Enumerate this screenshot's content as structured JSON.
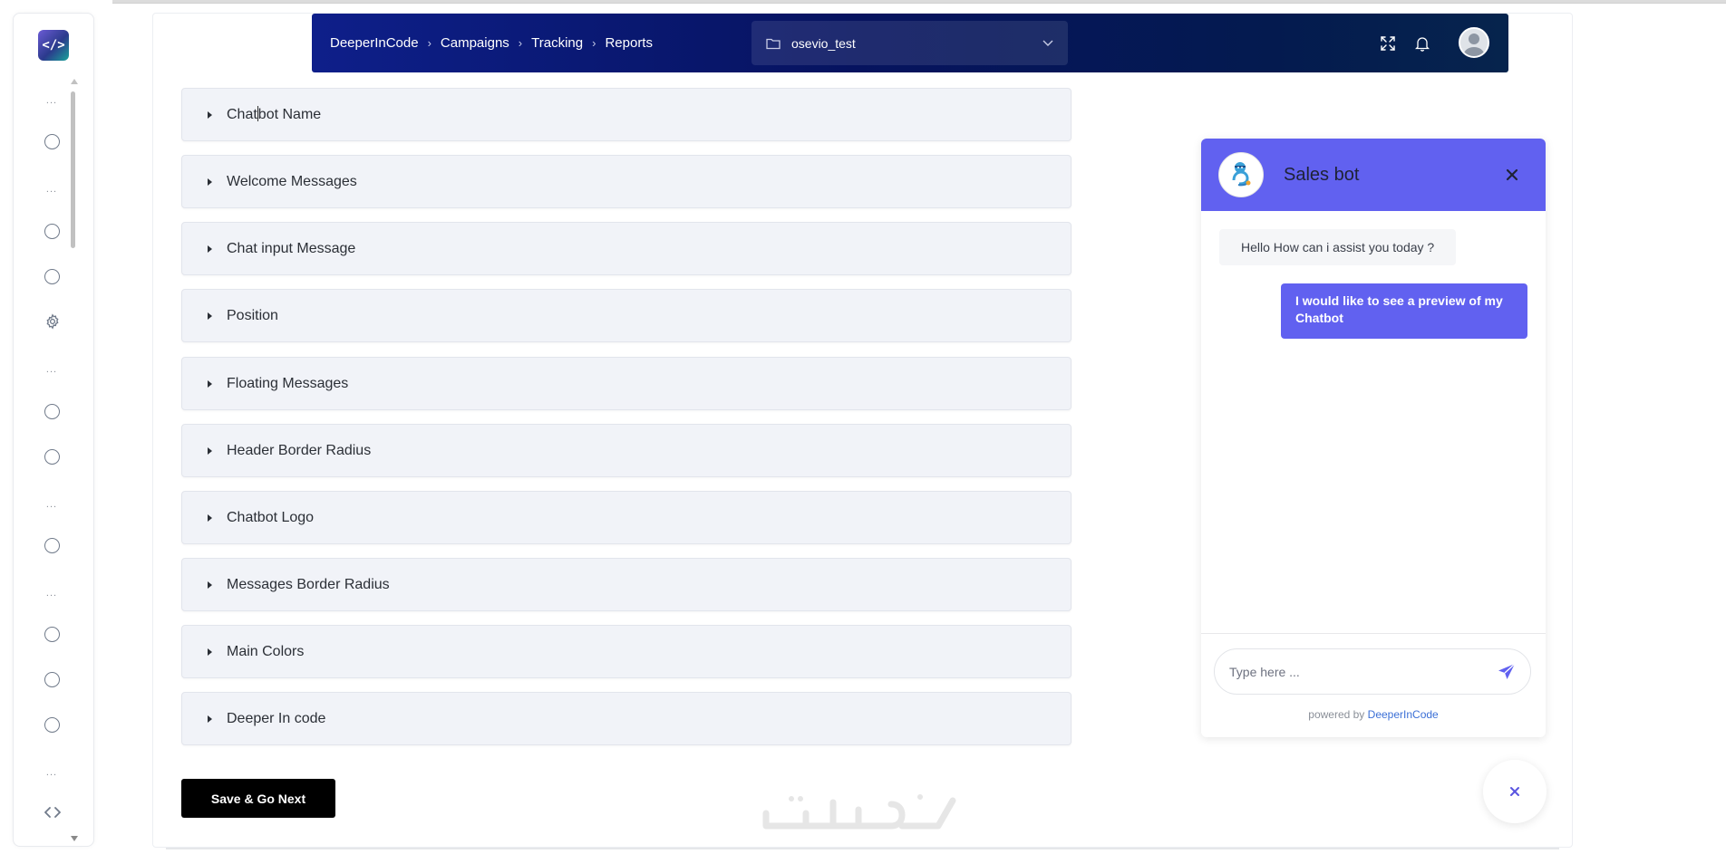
{
  "topbar": {
    "breadcrumbs": [
      "DeeperInCode",
      "Campaigns",
      "Tracking",
      "Reports"
    ],
    "project_select": {
      "value": "osevio_test"
    }
  },
  "sidebar": {
    "logo_glyph": "</>",
    "dots": "...",
    "icons": [
      "logo-icon",
      "circle-icon",
      "gear-icon",
      "code-icon"
    ]
  },
  "accordion": {
    "items": [
      {
        "label_pre": "Chat",
        "label_post": "bot Name"
      },
      {
        "label": "Welcome Messages"
      },
      {
        "label": "Chat input Message"
      },
      {
        "label": "Position"
      },
      {
        "label": "Floating Messages"
      },
      {
        "label": "Header Border Radius"
      },
      {
        "label": "Chatbot Logo"
      },
      {
        "label": "Messages Border Radius"
      },
      {
        "label": "Main Colors"
      },
      {
        "label": "Deeper In code"
      }
    ]
  },
  "save_button": {
    "label": "Save & Go Next"
  },
  "chat": {
    "title": "Sales bot",
    "messages": [
      {
        "from": "bot",
        "text": "Hello How can i assist you today ?"
      },
      {
        "from": "user",
        "text": "I would like to see a preview of my Chatbot"
      }
    ],
    "input": {
      "value": "",
      "placeholder": "Type here ..."
    },
    "powered_prefix": "powered by",
    "powered_brand": "DeeperInCode"
  },
  "colors": {
    "header_gradient_start": "#0e1f8a",
    "header_gradient_end": "#06244d",
    "chat_accent": "#6161f0",
    "accordion_bg": "#f1f3f8",
    "button_bg": "#000000"
  }
}
